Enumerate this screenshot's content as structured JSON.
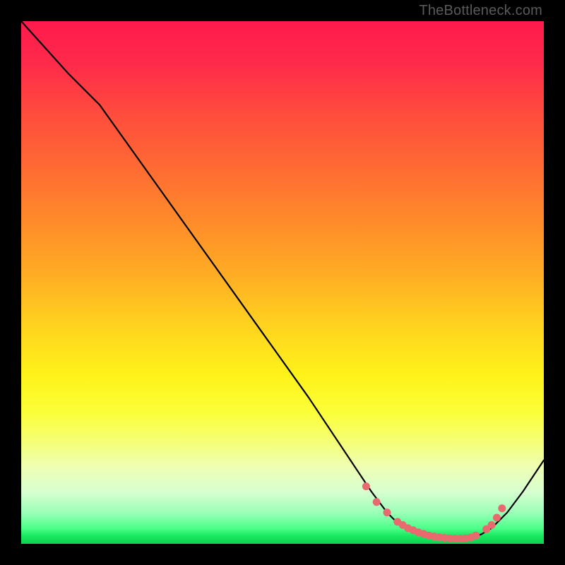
{
  "watermark": "TheBottleneck.com",
  "chart_data": {
    "type": "line",
    "title": "",
    "xlabel": "",
    "ylabel": "",
    "xlim": [
      0,
      100
    ],
    "ylim": [
      0,
      100
    ],
    "grid": false,
    "legend": false,
    "series": [
      {
        "name": "bottleneck-curve",
        "x": [
          0,
          9,
          15,
          25,
          35,
          45,
          55,
          63,
          67,
          70,
          72,
          74,
          76,
          78,
          80,
          82,
          84,
          86,
          88,
          90,
          93,
          96,
          100
        ],
        "y": [
          100,
          90,
          84,
          70,
          56,
          42,
          28,
          16,
          10,
          6,
          4,
          3,
          2,
          1.5,
          1.2,
          1.0,
          1.0,
          1.2,
          1.8,
          3,
          6,
          10,
          16
        ]
      }
    ],
    "markers": {
      "name": "highlight-dots",
      "x": [
        66,
        68,
        70,
        72,
        73,
        74,
        75,
        76,
        77,
        78,
        79,
        80,
        81,
        82,
        83,
        84,
        85,
        86,
        87,
        89,
        90,
        91,
        92
      ],
      "y": [
        11,
        8,
        6,
        4.2,
        3.6,
        3.0,
        2.6,
        2.2,
        1.9,
        1.6,
        1.4,
        1.25,
        1.15,
        1.05,
        1.0,
        1.0,
        1.05,
        1.2,
        1.6,
        2.8,
        3.6,
        5.0,
        6.8
      ]
    },
    "colors": {
      "curve": "#000000",
      "dots": "#e86a6f",
      "gradient_top": "#ff1a4d",
      "gradient_mid": "#fff31a",
      "gradient_bottom": "#0fd24f"
    }
  }
}
